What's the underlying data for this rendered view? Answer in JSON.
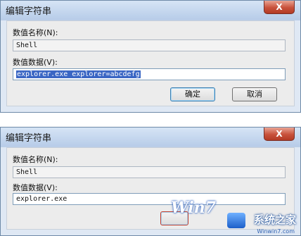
{
  "dialogs": [
    {
      "title": "编辑字符串",
      "close_label": "X",
      "name_label": "数值名称(N):",
      "name_value": "Shell",
      "data_label": "数值数据(V):",
      "data_value": "explorer.exe explorer=abcdefg",
      "ok_label": "确定",
      "cancel_label": "取消"
    },
    {
      "title": "编辑字符串",
      "close_label": "X",
      "name_label": "数值名称(N):",
      "name_value": "Shell",
      "data_label": "数值数据(V):",
      "data_value": "explorer.exe"
    }
  ],
  "watermark": {
    "logo": "Win7",
    "brand": "系统之家",
    "url": "Winwin7.com"
  },
  "colors": {
    "title_bar": "#c4d6ee",
    "close_button": "#c8513b",
    "selection": "#3a66c4",
    "default_button_border": "#3c7fb1"
  }
}
